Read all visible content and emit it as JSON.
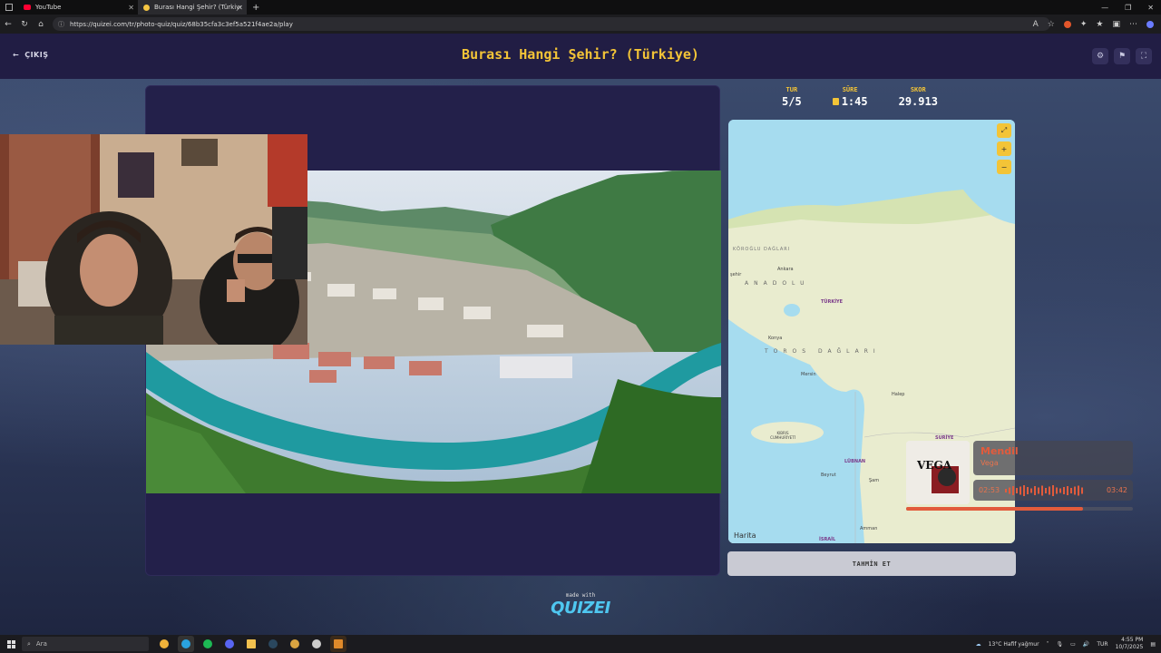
{
  "browser": {
    "tabs": [
      {
        "label": "YouTube",
        "icon": "youtube-icon"
      },
      {
        "label": "Burası Hangi Şehir? (Türkiye) - Q",
        "icon": "quizei-icon"
      }
    ],
    "url": "https://quizei.com/tr/photo-quiz/quiz/68b35cfa3c3ef5a521f4ae2a/play"
  },
  "header": {
    "back_label": "ÇIKIŞ",
    "title": "Burası Hangi Şehir? (Türkiye)"
  },
  "stats": {
    "round_label": "TUR",
    "round_value": "5/5",
    "time_label": "SÜRE",
    "time_value": "1:45",
    "score_label": "SKOR",
    "score_value": "29.913"
  },
  "map": {
    "attribution": "Harita",
    "labels": {
      "ankara": "Ankara",
      "turkiye": "TÜRKİYE",
      "konya": "Konya",
      "anadolu": "ANADOLU",
      "toros": "TOROS DAĞLARI",
      "koroglu": "KÖROĞLU DAĞLARI",
      "kibris": "KIBRIS CUMHURİYETİ",
      "lubnan": "LÜBNAN",
      "beyrut": "Beyrut",
      "suriye": "SURİYE",
      "sam": "Şam",
      "amman": "Amman",
      "israil": "İSRAİL",
      "mersin": "Mersin",
      "halep": "Halep",
      "sehir": "şehir"
    }
  },
  "guess_button": "TAHMİN ET",
  "footer": {
    "made_with": "made with",
    "logo": "QUIZEI"
  },
  "music": {
    "title": "Mendil",
    "artist": "Vega",
    "elapsed": "02:53",
    "duration": "03:42",
    "progress_fraction": 0.78,
    "album_text": "VEGA"
  },
  "taskbar": {
    "search_placeholder": "Ara",
    "weather": "13°C  Hafif yağmur",
    "language": "TUR",
    "time": "4:55 PM",
    "date": "10/7/2025"
  },
  "colors": {
    "accent_yellow": "#f3c437",
    "accent_orange": "#e25b3c",
    "logo_blue": "#4fc7f0"
  }
}
